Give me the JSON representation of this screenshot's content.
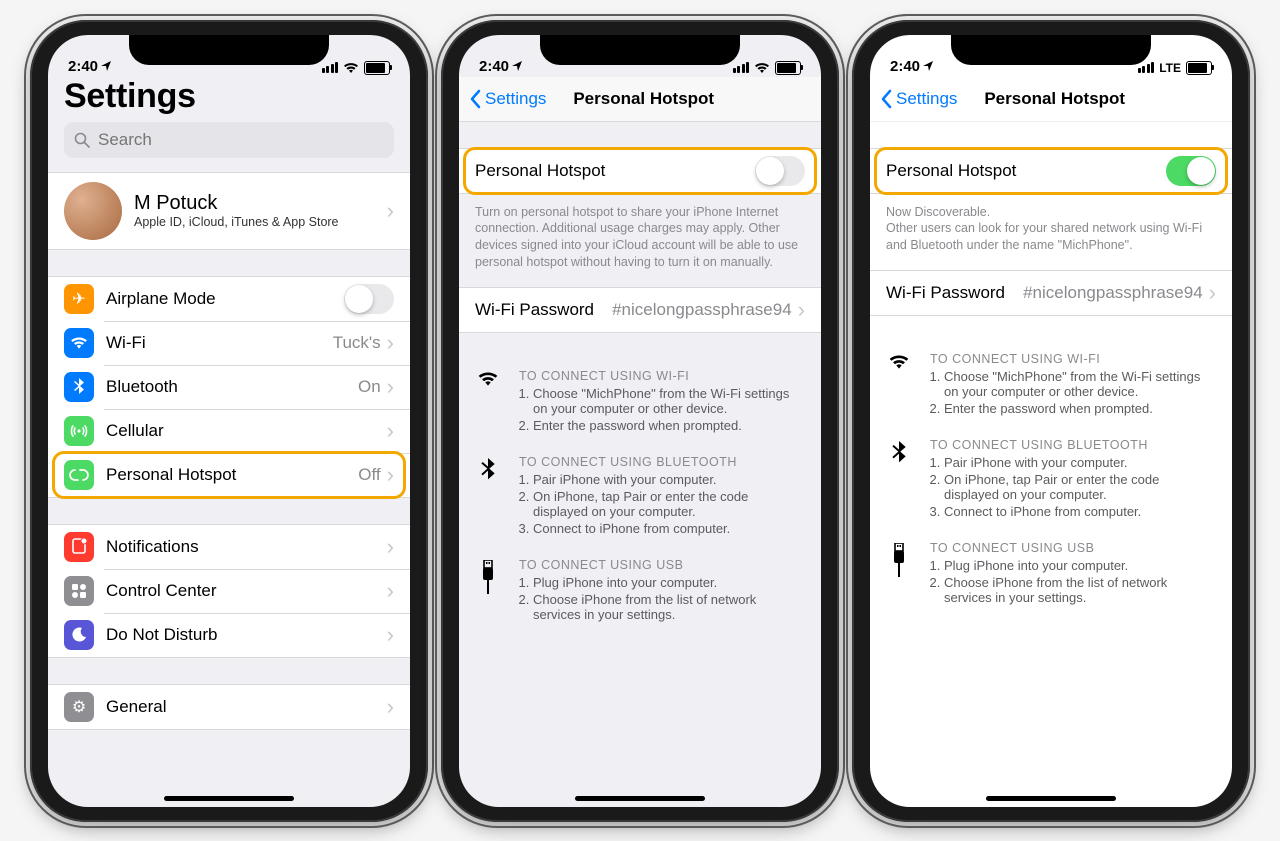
{
  "status": {
    "time": "2:40",
    "lte": "LTE"
  },
  "screen1": {
    "title": "Settings",
    "search_placeholder": "Search",
    "profile": {
      "name": "M Potuck",
      "sub": "Apple ID, iCloud, iTunes & App Store"
    },
    "items": {
      "airplane": {
        "label": "Airplane Mode",
        "color": "#ff9500"
      },
      "wifi": {
        "label": "Wi-Fi",
        "value": "Tuck's",
        "color": "#007aff"
      },
      "bluetooth": {
        "label": "Bluetooth",
        "value": "On",
        "color": "#007aff"
      },
      "cellular": {
        "label": "Cellular",
        "color": "#4cd964"
      },
      "hotspot": {
        "label": "Personal Hotspot",
        "value": "Off",
        "color": "#4cd964"
      },
      "notif": {
        "label": "Notifications",
        "color": "#ff3b30"
      },
      "control": {
        "label": "Control Center",
        "color": "#8e8e93"
      },
      "dnd": {
        "label": "Do Not Disturb",
        "color": "#5856d6"
      },
      "general": {
        "label": "General",
        "color": "#8e8e93"
      }
    }
  },
  "screen2": {
    "back": "Settings",
    "title": "Personal Hotspot",
    "toggle_label": "Personal Hotspot",
    "toggle_on": false,
    "help": "Turn on personal hotspot to share your iPhone Internet connection. Additional usage charges may apply. Other devices signed into your iCloud account will be able to use personal hotspot without having to turn it on manually.",
    "pw_label": "Wi-Fi Password",
    "pw_value": "#nicelongpassphrase94"
  },
  "screen3": {
    "back": "Settings",
    "title": "Personal Hotspot",
    "toggle_label": "Personal Hotspot",
    "toggle_on": true,
    "discover": "Now Discoverable.",
    "help": "Other users can look for your shared network using Wi-Fi and Bluetooth under the name \"MichPhone\".",
    "pw_label": "Wi-Fi Password",
    "pw_value": "#nicelongpassphrase94"
  },
  "instructions": {
    "wifi": {
      "title": "TO CONNECT USING WI-FI",
      "steps": [
        "Choose \"MichPhone\" from the Wi-Fi settings on your computer or other device.",
        "Enter the password when prompted."
      ]
    },
    "bt": {
      "title": "TO CONNECT USING BLUETOOTH",
      "steps": [
        "Pair iPhone with your computer.",
        "On iPhone, tap Pair or enter the code displayed on your computer.",
        "Connect to iPhone from computer."
      ]
    },
    "usb": {
      "title": "TO CONNECT USING USB",
      "steps": [
        "Plug iPhone into your computer.",
        "Choose iPhone from the list of network services in your settings."
      ]
    }
  }
}
